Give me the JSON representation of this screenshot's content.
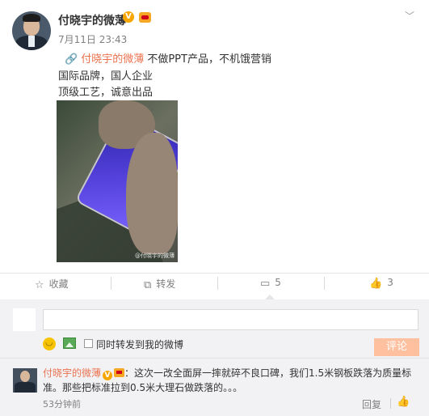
{
  "post": {
    "author": "付晓宇的微薄",
    "verified_badge": "V",
    "time": "7月11日 23:43",
    "mention": "付晓宇的微薄",
    "repost_text": "不做PPT产品，不机饿营销",
    "line2": "国际品牌，国人企业",
    "line3": "顶级工艺，诚意出品",
    "watermark": "@付晓宇的微薄"
  },
  "actions": {
    "favorite_label": "收藏",
    "forward_label": "转发",
    "comment_count": "5",
    "like_count": "3"
  },
  "composer": {
    "also_forward_label": "同时转发到我的微博",
    "submit_label": "评论"
  },
  "comment": {
    "author": "付晓宇的微薄",
    "text": "：这次一改全面屏一摔就碎不良口碑，我们1.5米钢板跌落为质量标准。那些把标准拉到0.5米大理石做跌落的。。。",
    "time": "53分钟前",
    "reply_label": "回复"
  },
  "colors": {
    "accent": "#eb7350",
    "submit_disabled": "#ffc09f",
    "comment_bg": "#f2f2f5",
    "verified": "#f7a600"
  }
}
